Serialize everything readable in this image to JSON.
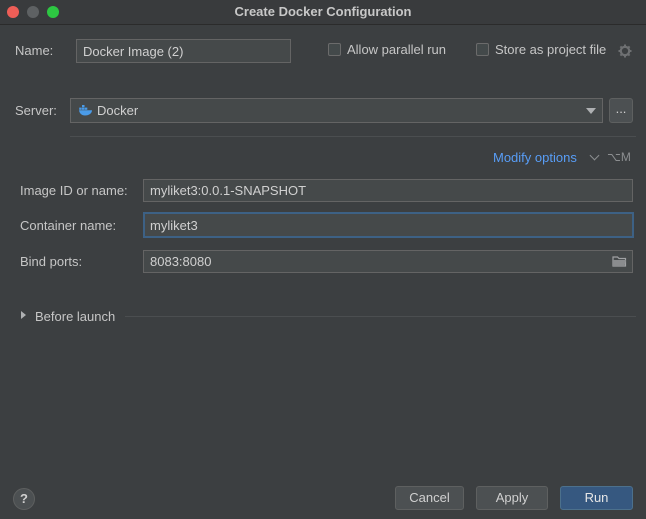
{
  "window": {
    "title": "Create Docker Configuration"
  },
  "name_row": {
    "label": "Name:",
    "value": "Docker Image (2)",
    "allow_parallel_label": "Allow parallel run",
    "store_project_label": "Store as project file"
  },
  "server": {
    "label": "Server:",
    "value": "Docker",
    "more_label": "..."
  },
  "options": {
    "modify_label": "Modify options",
    "shortcut": "⌥M"
  },
  "fields": {
    "image_label": "Image ID or name:",
    "image_value": "myliket3:0.0.1-SNAPSHOT",
    "container_label": "Container name:",
    "container_value": "myliket3",
    "ports_label": "Bind ports:",
    "ports_value": "8083:8080"
  },
  "before_launch": {
    "label": "Before launch"
  },
  "footer": {
    "help_label": "?",
    "cancel_label": "Cancel",
    "apply_label": "Apply",
    "run_label": "Run"
  },
  "colors": {
    "background": "#3c3f41",
    "link": "#589df6",
    "primary_button": "#365880",
    "focus_border": "#3d6185"
  }
}
